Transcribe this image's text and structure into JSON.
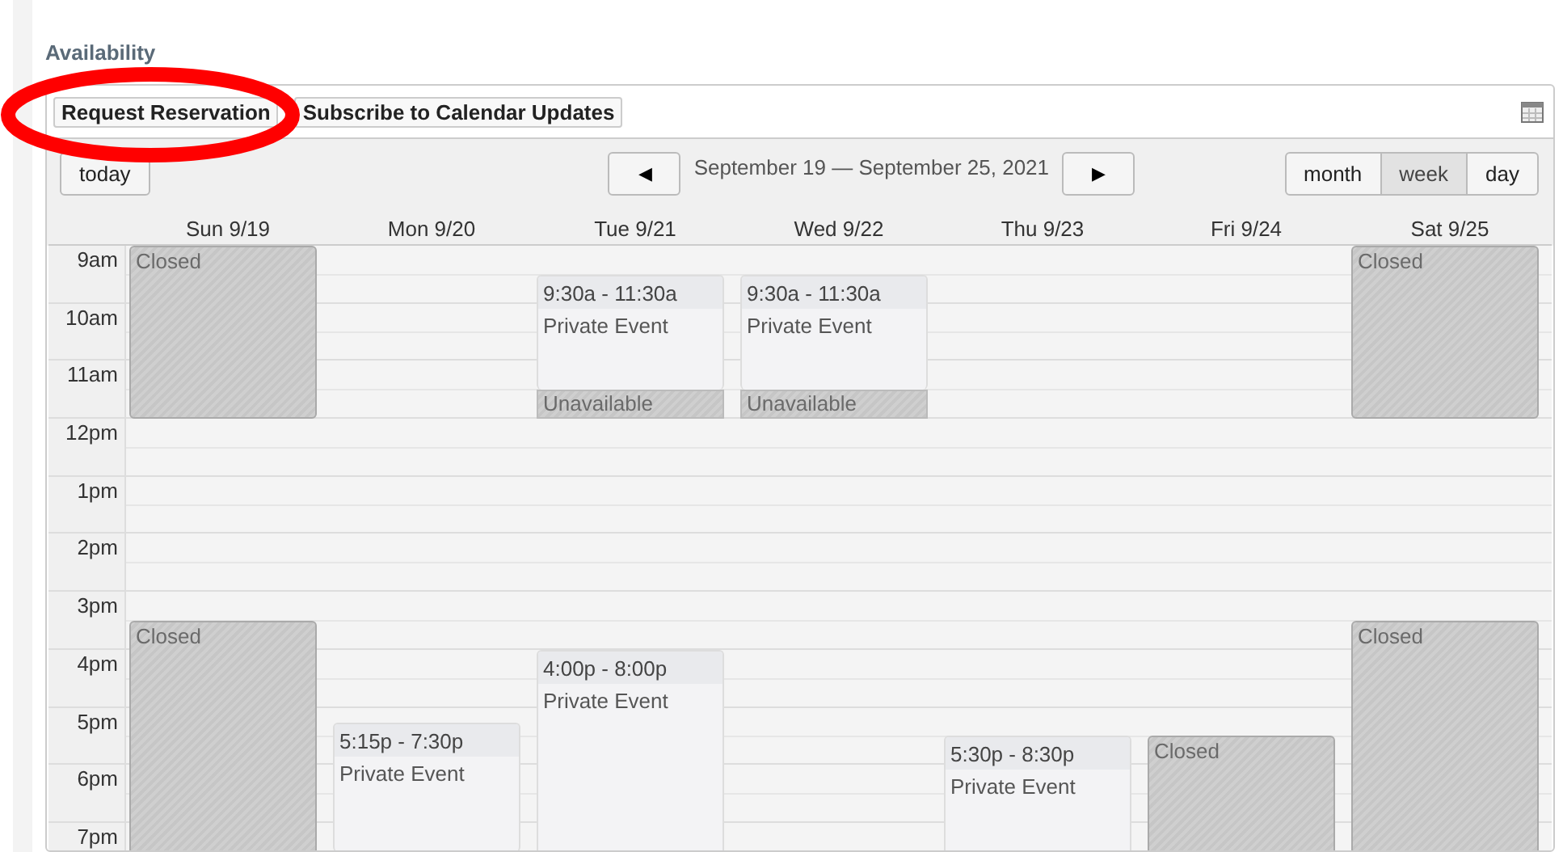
{
  "section": {
    "title": "Availability"
  },
  "toolbar": {
    "buttons": [
      "Request Reservation",
      "Subscribe to Calendar Updates"
    ]
  },
  "nav": {
    "today": "today",
    "prev": "◀",
    "range": "September 19 — September 25, 2021",
    "next": "▶"
  },
  "views": [
    {
      "label": "month",
      "selected": false
    },
    {
      "label": "week",
      "selected": true
    },
    {
      "label": "day",
      "selected": false
    }
  ],
  "hours": [
    "9am",
    "10am",
    "11am",
    "12pm",
    "1pm",
    "2pm",
    "3pm",
    "4pm",
    "5pm",
    "6pm",
    "7pm"
  ],
  "days": [
    {
      "label": "Sun 9/19",
      "events": [
        {
          "kind": "closed",
          "title": "Closed"
        },
        {
          "kind": "closed",
          "title": "Closed"
        }
      ]
    },
    {
      "label": "Mon 9/20",
      "events": [
        {
          "kind": "event",
          "time": "5:15p - 7:30p",
          "title": "Private Event"
        }
      ]
    },
    {
      "label": "Tue 9/21",
      "events": [
        {
          "kind": "event",
          "time": "9:30a - 11:30a",
          "title": "Private Event"
        },
        {
          "kind": "unavailable",
          "title": "Unavailable"
        },
        {
          "kind": "event",
          "time": "4:00p - 8:00p",
          "title": "Private Event"
        }
      ]
    },
    {
      "label": "Wed 9/22",
      "events": [
        {
          "kind": "event",
          "time": "9:30a - 11:30a",
          "title": "Private Event"
        },
        {
          "kind": "unavailable",
          "title": "Unavailable"
        }
      ]
    },
    {
      "label": "Thu 9/23",
      "events": [
        {
          "kind": "event",
          "time": "5:30p - 8:30p",
          "title": "Private Event"
        }
      ]
    },
    {
      "label": "Fri 9/24",
      "events": [
        {
          "kind": "closed",
          "title": "Closed"
        }
      ]
    },
    {
      "label": "Sat 9/25",
      "events": [
        {
          "kind": "closed",
          "title": "Closed"
        },
        {
          "kind": "closed",
          "title": "Closed"
        }
      ]
    }
  ]
}
